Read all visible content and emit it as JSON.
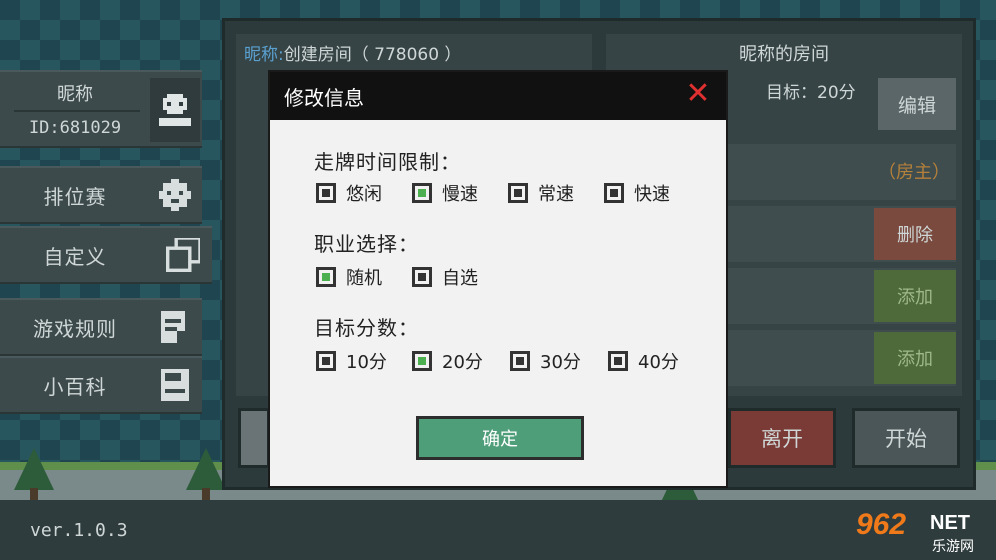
{
  "profile": {
    "nickname": "昵称",
    "id": "ID:681029",
    "avatar_icon": "skull-icon"
  },
  "menu": [
    {
      "label": "排位赛",
      "icon": "gear-monster-icon"
    },
    {
      "label": "自定义",
      "icon": "overlap-squares-icon"
    },
    {
      "label": "游戏规则",
      "icon": "document-icon"
    },
    {
      "label": "小百科",
      "icon": "save-disk-icon"
    }
  ],
  "room": {
    "nick_label": "昵称:",
    "name_text": "创建房间（ 778060 ）",
    "right_title": "昵称的房间",
    "target": "目标：20分",
    "edit": "编辑",
    "owner": "（房主）",
    "delete": "删除",
    "add1": "添加",
    "add2": "添加",
    "leave": "离开",
    "start": "开始"
  },
  "modal": {
    "title": "修改信息",
    "close_icon": "close-x-icon",
    "sections": {
      "time_limit": {
        "title": "走牌时间限制：",
        "options": [
          "悠闲",
          "慢速",
          "常速",
          "快速"
        ],
        "selected": "慢速"
      },
      "profession": {
        "title": "职业选择：",
        "options": [
          "随机",
          "自选"
        ],
        "selected": "随机"
      },
      "target_score": {
        "title": "目标分数：",
        "options": [
          "10分",
          "20分",
          "30分",
          "40分"
        ],
        "selected": "20分"
      }
    },
    "confirm": "确定"
  },
  "footer": {
    "version": "ver.1.0.3",
    "watermark_num": "962",
    "watermark_net": "NET",
    "watermark_sub": "乐游网"
  },
  "colors": {
    "checked": "#4caf50",
    "confirm_button": "#4f9e7a",
    "close_icon": "#e03030",
    "leave_button": "#7a3a36"
  }
}
